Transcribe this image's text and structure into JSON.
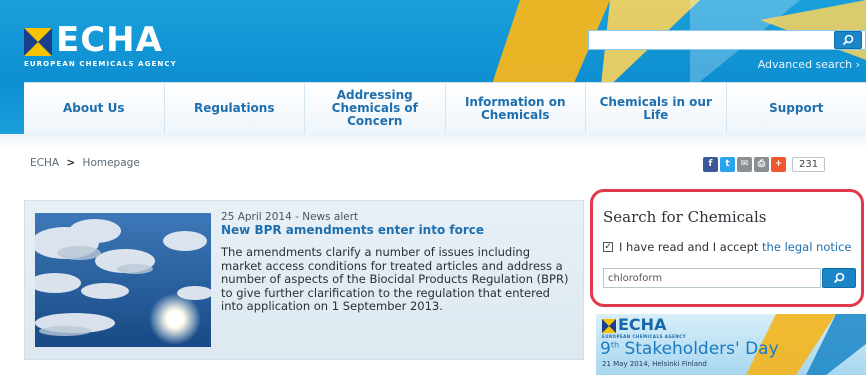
{
  "header": {
    "logo_text": "ECHA",
    "logo_subtitle": "EUROPEAN CHEMICALS AGENCY",
    "search_placeholder": "",
    "advanced_search_label": "Advanced search",
    "advanced_search_arrow": "›"
  },
  "nav": {
    "items": [
      {
        "label": "About Us"
      },
      {
        "label": "Regulations"
      },
      {
        "label": "Addressing Chemicals of Concern"
      },
      {
        "label": "Information on Chemicals"
      },
      {
        "label": "Chemicals in our Life"
      },
      {
        "label": "Support"
      }
    ]
  },
  "breadcrumb": {
    "root": "ECHA",
    "separator": ">",
    "current": "Homepage"
  },
  "share": {
    "buttons": [
      {
        "icon": "facebook-icon",
        "glyph": "f",
        "color": "#3b5998"
      },
      {
        "icon": "twitter-icon",
        "glyph": "t",
        "color": "#2aa3ef"
      },
      {
        "icon": "email-icon",
        "glyph": "✉",
        "color": "#8a8f94"
      },
      {
        "icon": "print-icon",
        "glyph": "⎙",
        "color": "#8a8f94"
      },
      {
        "icon": "plus-icon",
        "glyph": "+",
        "color": "#f0562b"
      }
    ],
    "count": "231"
  },
  "news": {
    "date_line": "25 April 2014 - News alert",
    "title": "New BPR amendments enter into force",
    "body": "The amendments clarify a number of issues including market access conditions for treated articles and address a number of aspects of the Biocidal Products Regulation (BPR) to give further clarification to the regulation that entered into application on 1 September 2013."
  },
  "chemical_search": {
    "title": "Search for Chemicals",
    "checkbox_mark": "✓",
    "accept_text": "I have read and I accept ",
    "legal_notice_link": "the legal notice",
    "input_value": "chloroform"
  },
  "banner": {
    "logo_text": "ECHA",
    "logo_subtitle": "EUROPEAN CHEMICALS AGENCY",
    "ordinal": "9",
    "ordinal_suffix": "th",
    "title": " Stakeholders' Day",
    "date_location": "21 May 2014, Helsinki Finland"
  },
  "colors": {
    "header_blue": "#0d8ed0",
    "nav_text": "#1f6fae",
    "logo_yellow": "#f7c200",
    "highlight_red": "#e0394a",
    "search_button": "#1a86c7"
  }
}
